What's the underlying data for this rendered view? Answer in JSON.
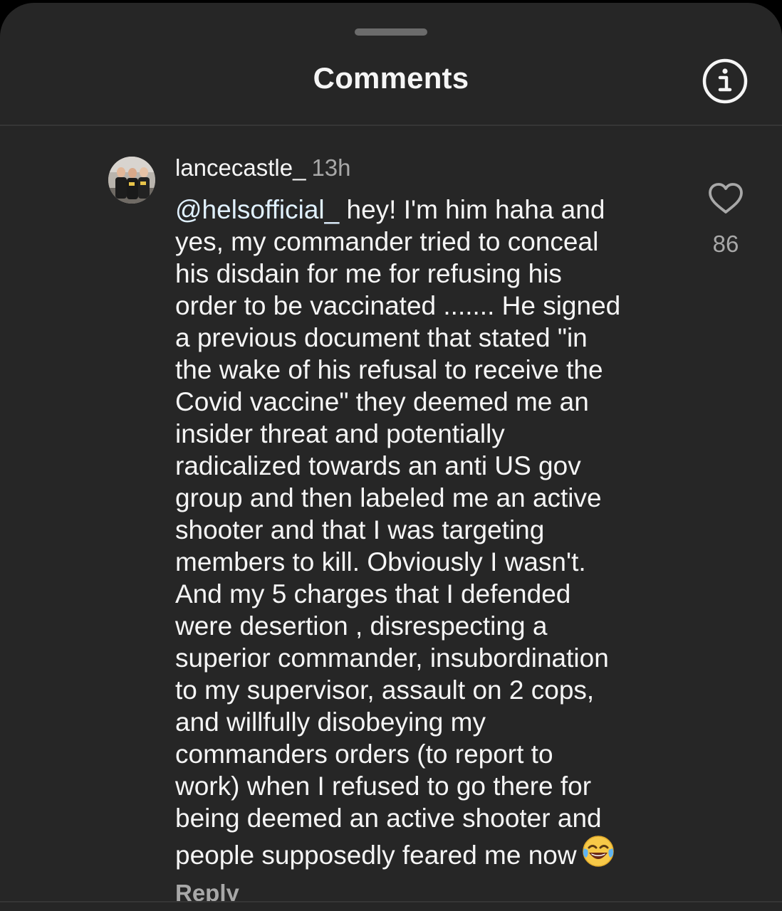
{
  "header": {
    "title": "Comments",
    "info_icon": "info-icon"
  },
  "comment": {
    "username": "lancecastle_",
    "timestamp": "13h",
    "mention": "@helsofficial_",
    "text": " hey! I'm him haha and\nyes, my commander tried to conceal\nhis disdain for me for refusing his\norder to be vaccinated ....... He signed\na previous document that stated \"in\nthe wake of his refusal to receive the\nCovid vaccine\" they deemed me an\ninsider threat and potentially\nradicalized towards an anti US gov\ngroup and then labeled me an active\nshooter and that I was targeting\nmembers to kill. Obviously I wasn't.\nAnd my 5 charges that I defended\nwere desertion , disrespecting a\nsuperior commander, insubordination\nto my supervisor, assault on 2 cops,\nand willfully disobeying my\ncommanders orders (to report to\nwork) when I refused to go there for\nbeing deemed an active shooter and\npeople supposedly feared me now",
    "emoji": "face-with-tears-of-joy",
    "like_icon": "heart-icon",
    "like_count": "86",
    "reply_label": "Reply"
  },
  "colors": {
    "sheet_background": "#262626",
    "primary_text": "#f5f5f5",
    "secondary_text": "#a8a8a8",
    "mention_text": "#e0f1ff",
    "divider": "#363636"
  }
}
